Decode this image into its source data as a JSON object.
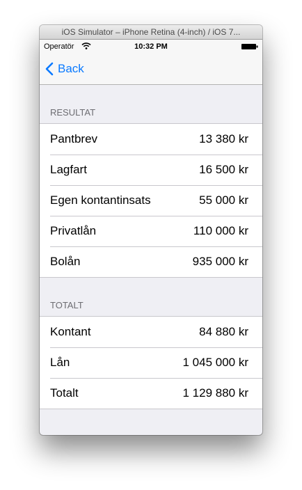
{
  "window": {
    "title": "iOS Simulator – iPhone Retina (4-inch) / iOS 7..."
  },
  "status_bar": {
    "carrier": "Operatör",
    "time": "10:32 PM"
  },
  "nav": {
    "back_label": "Back"
  },
  "sections": [
    {
      "header": "RESULTAT",
      "rows": [
        {
          "label": "Pantbrev",
          "value": "13 380 kr"
        },
        {
          "label": "Lagfart",
          "value": "16 500 kr"
        },
        {
          "label": "Egen kontantinsats",
          "value": "55 000 kr"
        },
        {
          "label": "Privatlån",
          "value": "110 000 kr"
        },
        {
          "label": "Bolån",
          "value": "935 000 kr"
        }
      ]
    },
    {
      "header": "TOTALT",
      "rows": [
        {
          "label": "Kontant",
          "value": "84 880 kr"
        },
        {
          "label": "Lån",
          "value": "1 045 000 kr"
        },
        {
          "label": "Totalt",
          "value": "1 129 880 kr"
        }
      ]
    }
  ],
  "icons": {
    "back": "chevron-left-icon",
    "wifi": "wifi-icon",
    "battery": "battery-icon"
  },
  "colors": {
    "accent": "#0a7aff",
    "background": "#efeff4",
    "separator": "#c8c7cc"
  }
}
